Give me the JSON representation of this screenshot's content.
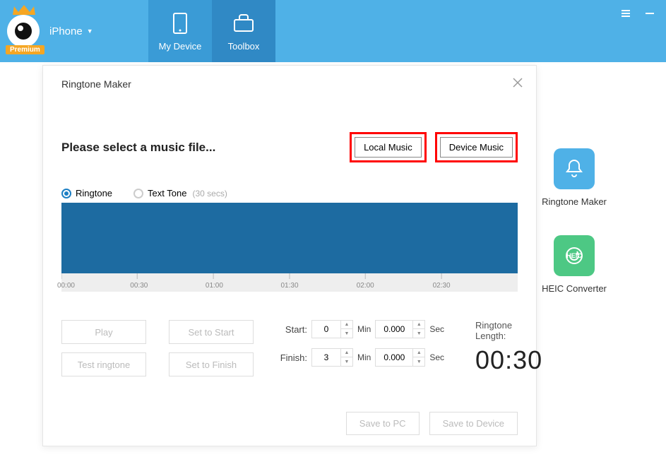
{
  "header": {
    "premium": "Premium",
    "device": "iPhone",
    "tabs": {
      "myDevice": "My Device",
      "toolbox": "Toolbox"
    }
  },
  "sideTiles": {
    "ringtone": "Ringtone Maker",
    "heic": "HEIC Converter",
    "heicIconText": "HEIC"
  },
  "modal": {
    "title": "Ringtone Maker",
    "prompt": "Please select a music file...",
    "localMusic": "Local Music",
    "deviceMusic": "Device Music",
    "radios": {
      "ringtone": "Ringtone",
      "textTone": "Text Tone",
      "textToneHint": "(30 secs)"
    },
    "timeline": {
      "labels": [
        "00:00",
        "00:30",
        "01:00",
        "01:30",
        "02:00",
        "02:30"
      ]
    },
    "buttons": {
      "play": "Play",
      "testRingtone": "Test ringtone",
      "setStart": "Set to Start",
      "setFinish": "Set to Finish"
    },
    "timeEdit": {
      "startLabel": "Start:",
      "finishLabel": "Finish:",
      "startMin": "0",
      "startSec": "0.000",
      "finishMin": "3",
      "finishSec": "0.000",
      "minUnit": "Min",
      "secUnit": "Sec"
    },
    "length": {
      "label": "Ringtone Length:",
      "value": "00:30"
    },
    "save": {
      "pc": "Save to PC",
      "device": "Save to Device"
    }
  }
}
